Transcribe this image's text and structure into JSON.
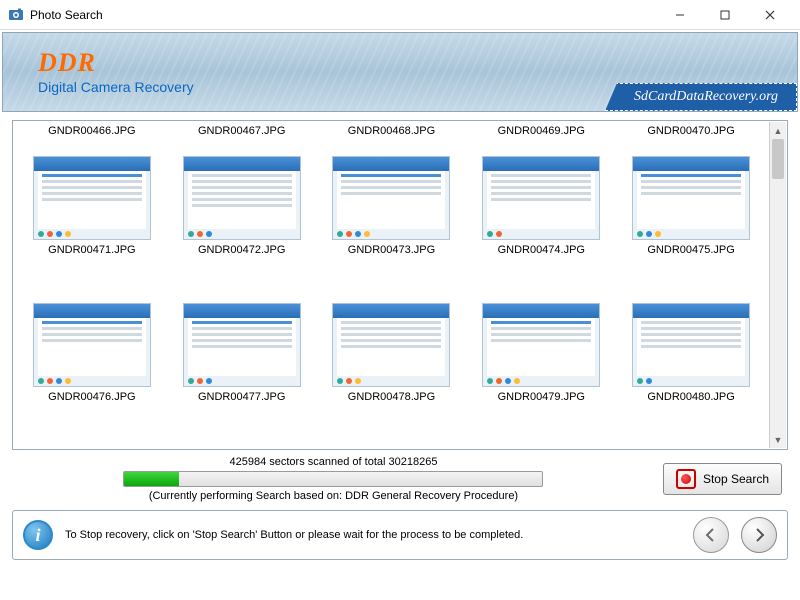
{
  "window": {
    "title": "Photo Search"
  },
  "banner": {
    "logo": "DDR",
    "subtitle": "Digital Camera Recovery",
    "site": "SdCardDataRecovery.org"
  },
  "thumbs": {
    "row0": [
      "GNDR00466.JPG",
      "GNDR00467.JPG",
      "GNDR00468.JPG",
      "GNDR00469.JPG",
      "GNDR00470.JPG"
    ],
    "row1": [
      "GNDR00471.JPG",
      "GNDR00472.JPG",
      "GNDR00473.JPG",
      "GNDR00474.JPG",
      "GNDR00475.JPG"
    ],
    "row2": [
      "GNDR00476.JPG",
      "GNDR00477.JPG",
      "GNDR00478.JPG",
      "GNDR00479.JPG",
      "GNDR00480.JPG"
    ]
  },
  "progress": {
    "text": "425984 sectors scanned of total 30218265",
    "subtext": "(Currently performing Search based on:  DDR General Recovery Procedure)",
    "stop_label": "Stop Search"
  },
  "footer": {
    "info_glyph": "i",
    "text": "To Stop recovery, click on 'Stop Search' Button or please wait for the process to be completed."
  }
}
